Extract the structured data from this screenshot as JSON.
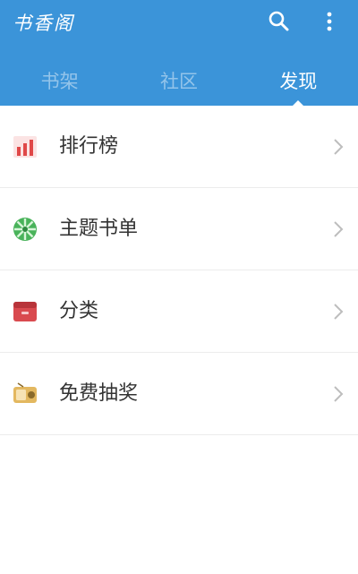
{
  "app": {
    "title": "书香阁"
  },
  "toolbar": {
    "search_icon": "search-icon",
    "more_icon": "more-vert-icon"
  },
  "tabs": [
    {
      "label": "书架",
      "active": false
    },
    {
      "label": "社区",
      "active": false
    },
    {
      "label": "发现",
      "active": true
    }
  ],
  "discover": {
    "items": [
      {
        "label": "排行榜",
        "icon": "bar-chart-icon",
        "color": "#e04848"
      },
      {
        "label": "主题书单",
        "icon": "green-wheel-icon",
        "color": "#49b35a"
      },
      {
        "label": "分类",
        "icon": "category-box-icon",
        "color": "#d94a4f"
      },
      {
        "label": "免费抽奖",
        "icon": "lottery-radio-icon",
        "color": "#e3b860"
      }
    ]
  },
  "colors": {
    "appbar": "#3b94d9",
    "text": "#333333",
    "chevron": "#bdbdbd"
  }
}
